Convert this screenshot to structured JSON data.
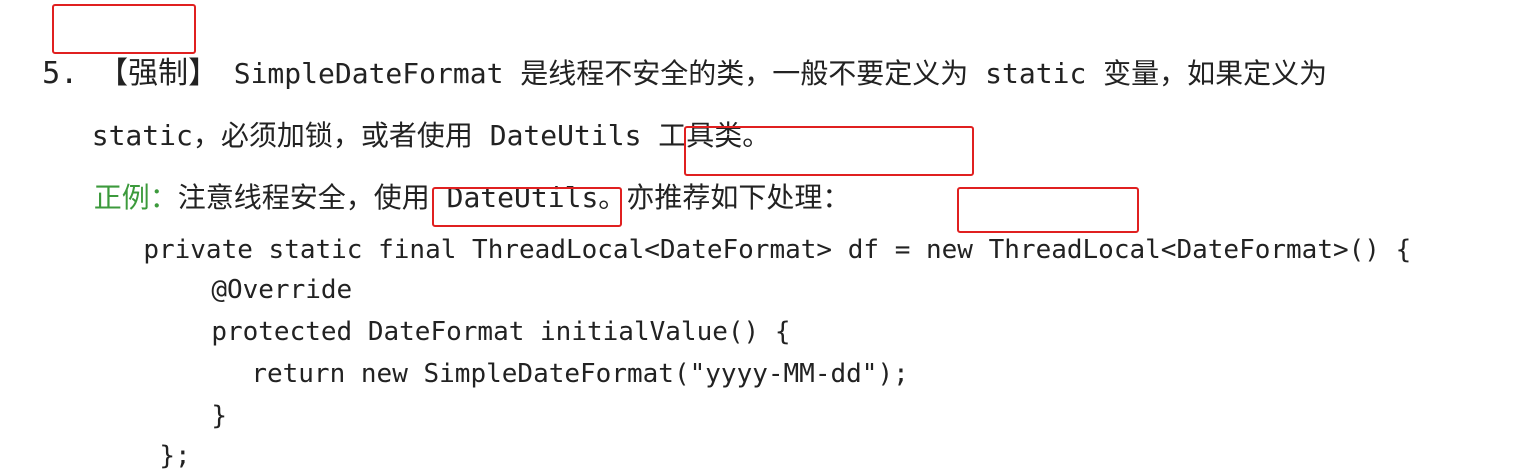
{
  "rule": {
    "number": "5.",
    "tag": "【强制】",
    "line1_rest": "SimpleDateFormat 是线程不安全的类，一般不要定义为 static 变量，如果定义为",
    "line2": "static，必须加锁，或者使用 DateUtils 工具类。"
  },
  "example": {
    "label": "正例：",
    "text": "注意线程安全，使用 DateUtils。",
    "highlight": "亦推荐如下处理："
  },
  "code": {
    "line1_pre": "private static final ",
    "line1_type1": "ThreadLocal",
    "line1_mid": "<DateFormat> df = new ",
    "line1_type2": "ThreadLocal",
    "line1_post": "<DateFormat>() {",
    "line2": "@Override",
    "line3": "protected DateFormat initialValue() {",
    "line4": "return new SimpleDateFormat(\"yyyy-MM-dd\");",
    "line5": "}",
    "line6": "};"
  },
  "colors": {
    "text": "#222222",
    "example_label": "#3c9a3c",
    "highlight_border": "#e02020"
  }
}
